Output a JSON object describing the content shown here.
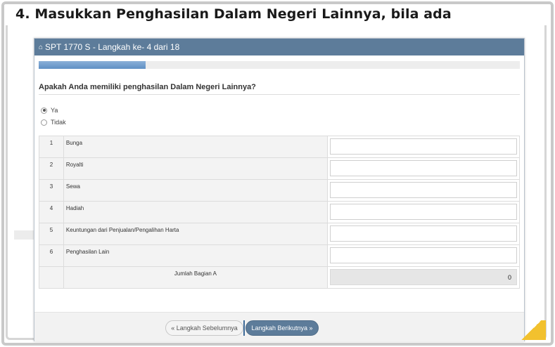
{
  "slide": {
    "title": "4. Masukkan Penghasilan Dalam Negeri Lainnya, bila ada"
  },
  "window": {
    "icon": "home-icon",
    "title": "SPT 1770 S - Langkah ke- 4 dari 18",
    "progress_fraction": 0.222
  },
  "form": {
    "question": "Apakah Anda memiliki penghasilan Dalam Negeri Lainnya?",
    "options": [
      {
        "label": "Ya",
        "selected": true
      },
      {
        "label": "Tidak",
        "selected": false
      }
    ],
    "rows": [
      {
        "no": "1",
        "label": "Bunga",
        "value": ""
      },
      {
        "no": "2",
        "label": "Royalti",
        "value": ""
      },
      {
        "no": "3",
        "label": "Sewa",
        "value": ""
      },
      {
        "no": "4",
        "label": "Hadiah",
        "value": ""
      },
      {
        "no": "5",
        "label": "Keuntungan dari Penjualan/Pengalihan Harta",
        "value": ""
      },
      {
        "no": "6",
        "label": "Penghasilan Lain",
        "value": ""
      }
    ],
    "total": {
      "label": "Jumlah Bagian A",
      "value": "0"
    }
  },
  "buttons": {
    "prev": "Langkah Sebelumnya",
    "next": "Langkah Berikutnya"
  },
  "colors": {
    "header": "#5d7c9a",
    "progress": "#6f9acb",
    "accent": "#f2c12e"
  }
}
